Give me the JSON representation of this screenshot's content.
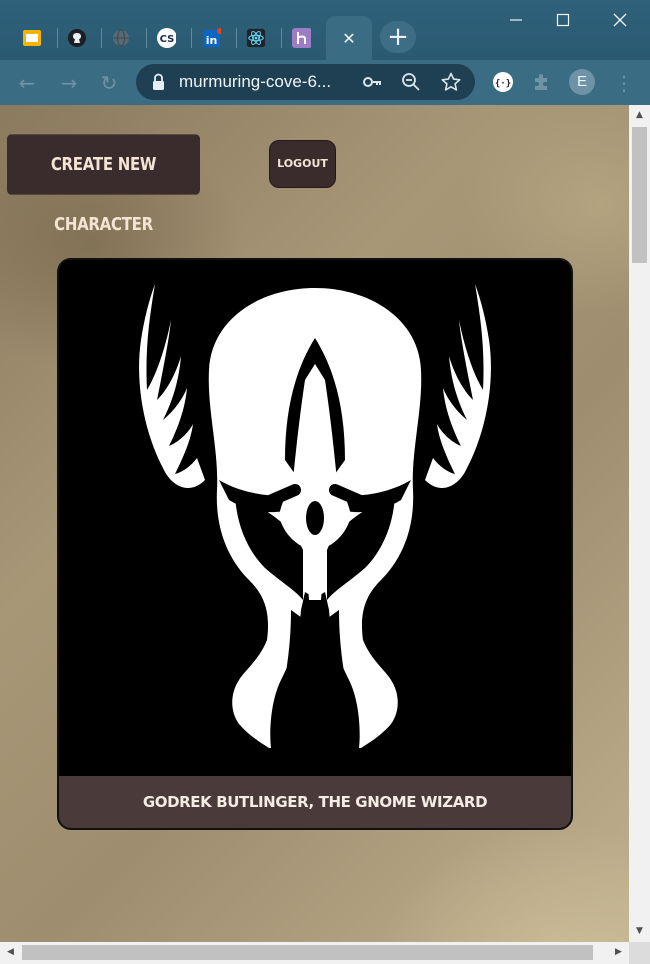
{
  "browser": {
    "tabs": [
      {
        "icon": "slides-icon",
        "label": ""
      },
      {
        "icon": "github-icon",
        "label": ""
      },
      {
        "icon": "globe-icon",
        "label": ""
      },
      {
        "icon": "cs-icon",
        "label": "CS"
      },
      {
        "icon": "linkedin-icon",
        "label": "in"
      },
      {
        "icon": "react-icon",
        "label": ""
      },
      {
        "icon": "heroku-icon",
        "label": ""
      }
    ],
    "active_tab_close": "✕",
    "new_tab": "+",
    "url": "murmuring-cove-6...",
    "profile_initial": "E"
  },
  "page": {
    "create_button": "Create New Character",
    "logout_button": "Logout",
    "character": {
      "name": "Godrek Butlinger, The Gnome Wizard",
      "image_icon": "winged-helmet-icon"
    }
  },
  "colors": {
    "button_bg": "#3a2b2c",
    "button_text": "#f4e4d4",
    "caption_bg": "#4a3a3a",
    "chrome_bg": "#2e617a"
  }
}
